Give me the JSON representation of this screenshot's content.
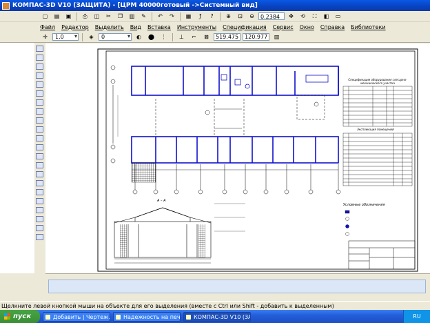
{
  "window": {
    "title": "КОМПАС-3D V10 (ЗАЩИТА) - [ЦРМ 40000готовый ->Системный вид]"
  },
  "toolbar": {
    "zoom_value": "0.2384"
  },
  "menu": [
    "Файл",
    "Редактор",
    "Выделить",
    "Вид",
    "Вставка",
    "Инструменты",
    "Спецификация",
    "Сервис",
    "Окно",
    "Справка",
    "Библиотеки"
  ],
  "props": {
    "line_scale": "1.0",
    "layer": "0",
    "coord_x": "519.475",
    "coord_y": "120.977"
  },
  "drawing": {
    "table_title": "Спецификация оборудования слесарно-механического участка",
    "table2_title": "Экспликация помещений",
    "legend_title": "Условные обозначения",
    "section_label": "А – А"
  },
  "status": {
    "hint": "Щелкните левой кнопкой мыши на объекте для его выделения (вместе с Ctrl или Shift - добавить к выделенным)"
  },
  "taskbar": {
    "start": "пуск",
    "tasks": [
      "Добавить | Чертеж...",
      "Надежность на печ...",
      "КОМПАС-3D V10 (ЗА..."
    ],
    "lang": "RU"
  },
  "colors": {
    "wall_blue": "#1010cc",
    "title_blue": "#0842c0"
  }
}
